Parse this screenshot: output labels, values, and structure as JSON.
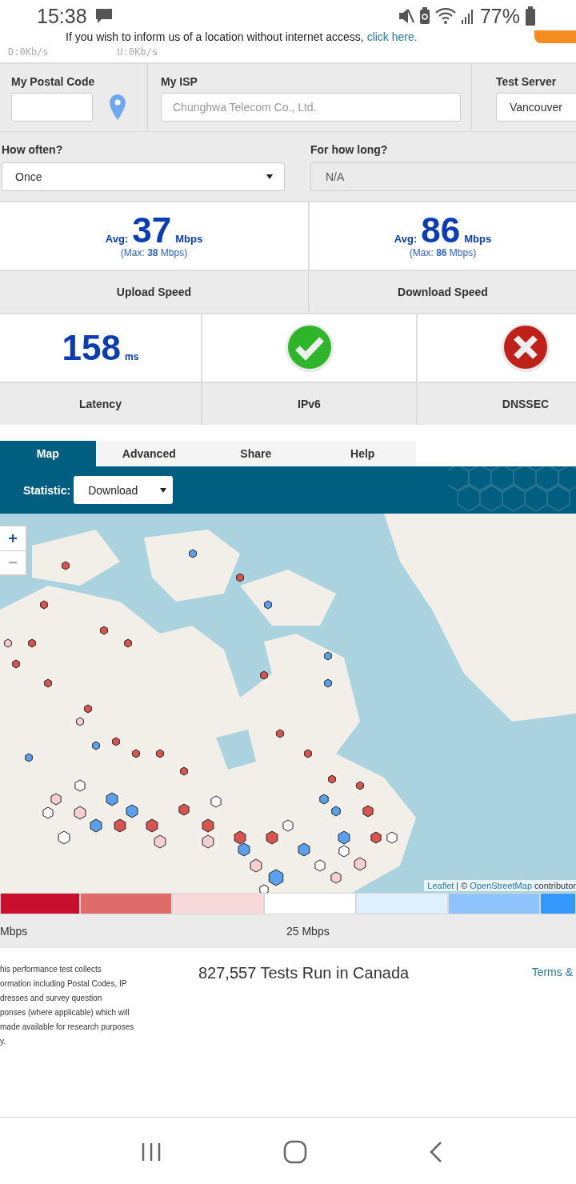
{
  "status_bar": {
    "time": "15:38",
    "battery": "77%"
  },
  "net_speed": {
    "download": "D:0Kb/s",
    "upload": "U:0Kb/s"
  },
  "notice": {
    "text": "If you wish to inform us of a location without internet access,",
    "link": "click here."
  },
  "postal_code": {
    "label": "My Postal Code"
  },
  "isp": {
    "label": "My ISP",
    "placeholder": "Chunghwa Telecom Co., Ltd."
  },
  "test_server": {
    "label": "Test Server",
    "value": "Vancouver"
  },
  "how_often": {
    "label": "How often?",
    "value": "Once"
  },
  "how_long": {
    "label": "For how long?",
    "value": "N/A",
    "disabled": true
  },
  "speeds": [
    {
      "avg_label": "Avg:",
      "value": "37",
      "unit": "Mbps",
      "max": "(Max: **38** Mbps)",
      "label": "Upload Speed"
    },
    {
      "avg_label": "Avg:",
      "value": "86",
      "unit": "Mbps",
      "max": "(Max: **86** Mbps)",
      "label": "Download Speed"
    }
  ],
  "checks": [
    {
      "kind": "latency",
      "value": "158",
      "unit": "ms",
      "label": "Latency"
    },
    {
      "kind": "status",
      "passed": true,
      "label": "IPv6"
    },
    {
      "kind": "status",
      "passed": false,
      "label": "DNSSEC"
    }
  ],
  "tabs": [
    {
      "label": "Map",
      "selected": true
    },
    {
      "label": "Advanced",
      "selected": false
    },
    {
      "label": "Share",
      "selected": false
    },
    {
      "label": "Help",
      "selected": false
    }
  ],
  "statistic": {
    "label": "Statistic:",
    "value": "Download"
  },
  "map": {
    "zoom_in": "+",
    "zoom_out": "−",
    "attribution_link_1": "Leaflet",
    "separator": "| ©",
    "attribution_link_2": "OpenStreetMap",
    "attribution_text": "contributor"
  },
  "legend": {
    "colors": [
      {
        "color": "#c8102e"
      },
      {
        "color": "#e06c6a"
      },
      {
        "color": "#f7d9da"
      },
      {
        "color": "#ffffff"
      },
      {
        "color": "#e0efff"
      },
      {
        "color": "#8ec4ff"
      },
      {
        "color": "#3399ff"
      }
    ],
    "labels": [
      "Mbps",
      "25 Mbps"
    ]
  },
  "disclaimer_lines": [
    "his performance test collects",
    "ormation including Postal Codes, IP",
    "dresses and survey question",
    "ponses (where applicable) which will",
    "made available for research purposes",
    "y."
  ],
  "tests_run": "827,557 Tests Run in Canada",
  "terms": "Terms &"
}
